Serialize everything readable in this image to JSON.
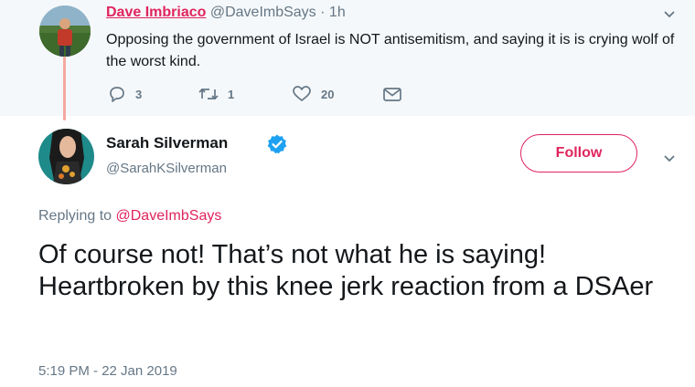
{
  "parent_tweet": {
    "display_name": "Dave Imbriaco",
    "handle": "@DaveImbSays",
    "separator": "·",
    "time_ago": "1h",
    "text": "Opposing the government of Israel is NOT antisemitism, and saying it is is crying wolf of the worst kind.",
    "reply_count": "3",
    "retweet_count": "1",
    "like_count": "20",
    "icons": [
      "reply-icon",
      "retweet-icon",
      "like-icon",
      "direct-message-icon",
      "chevron-down-icon"
    ]
  },
  "main_tweet": {
    "display_name": "Sarah Silverman",
    "handle": "@SarahKSilverman",
    "follow_label": "Follow",
    "replying_prefix": "Replying to",
    "replying_to": "@DaveImbSays",
    "text": "Of course not! That’s not what he is saying! Heartbroken by this knee jerk reaction from a DSAer",
    "timestamp": "5:19 PM - 22 Jan 2019",
    "icons": [
      "verified-badge-icon",
      "chevron-down-icon"
    ]
  },
  "colors": {
    "accent": "#e0245e",
    "muted": "#657786",
    "verified": "#1da1f2",
    "parent_background": "#f5f8fa",
    "thread_line": "#f5a9a0"
  }
}
